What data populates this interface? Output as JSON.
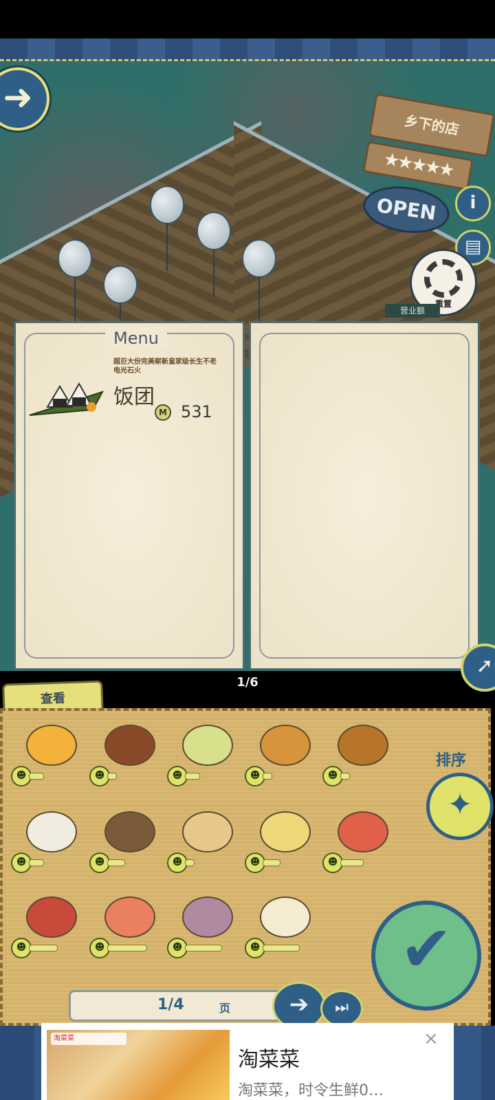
{
  "scene": {
    "shop_name": "乡下的店",
    "rating_stars": "★★★★★",
    "open_sign": "OPEN",
    "reset_label": "重置",
    "revenue_label": "营业额",
    "info_icon": "i"
  },
  "menu": {
    "title": "Menu",
    "dish": {
      "description": "超巨大份完美崭新皇家级长生不老电光石火",
      "name": "饭团",
      "price": "531",
      "coin_icon": "M"
    },
    "page_indicator": "1/6"
  },
  "panel": {
    "view_tab": "查看",
    "sort_label": "排序",
    "confirm_label": "没问题!",
    "pager_current": "1/4",
    "pager_unit": "页",
    "items": [
      {
        "icon": "omelette-rice-icon",
        "color": "#f3b23a",
        "level": 0.25
      },
      {
        "icon": "beef-bowl-icon",
        "color": "#8a4a2a",
        "level": 0.15
      },
      {
        "icon": "green-tea-icon",
        "color": "#d8e08a",
        "level": 0.25
      },
      {
        "icon": "tonkatsu-icon",
        "color": "#d8943a",
        "level": 0.15
      },
      {
        "icon": "yakitori-icon",
        "color": "#b8742a",
        "level": 0.15
      },
      {
        "icon": "coffee-cup-icon",
        "color": "#f0ece0",
        "level": 0.25
      },
      {
        "icon": "udon-bowl-icon",
        "color": "#7a5a3a",
        "level": 0.3
      },
      {
        "icon": "baguette-icon",
        "color": "#e8c88a",
        "level": 0.15
      },
      {
        "icon": "pudding-icon",
        "color": "#f0d87a",
        "level": 0.3
      },
      {
        "icon": "sashimi-icon",
        "color": "#e0604a",
        "level": 0.4
      },
      {
        "icon": "bento-icon",
        "color": "#c84a3a",
        "level": 0.5
      },
      {
        "icon": "shrimp-plate-icon",
        "color": "#ea8060",
        "level": 0.7
      },
      {
        "icon": "purple-rice-icon",
        "color": "#b08aa0",
        "level": 0.65
      },
      {
        "icon": "parfait-icon",
        "color": "#f4ecd0",
        "level": 0.65
      }
    ]
  },
  "ad": {
    "logo_text": "淘菜菜",
    "title": "淘菜菜",
    "subtitle": "淘菜菜，时令生鲜0…",
    "close_icon": "×"
  }
}
